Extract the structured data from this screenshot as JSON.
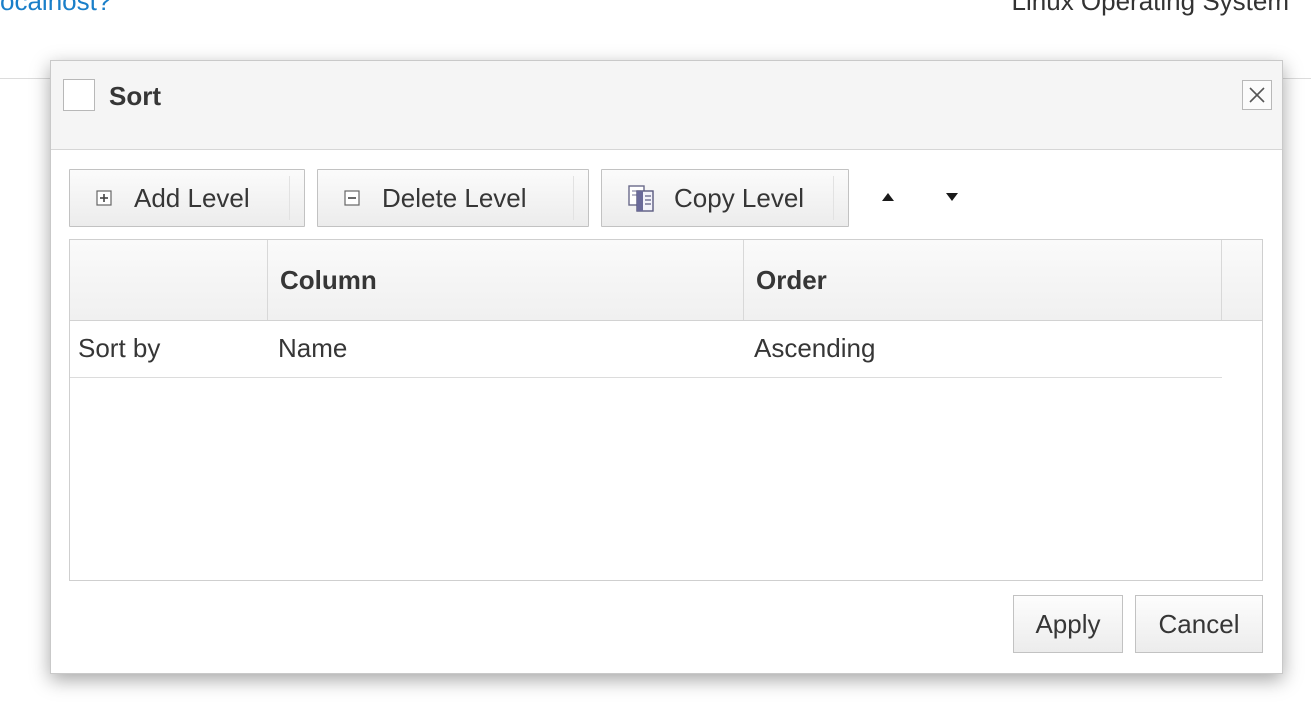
{
  "background": {
    "left_link_text": "ocalhost?",
    "right_text": "Linux Operating System"
  },
  "dialog": {
    "title": "Sort",
    "close_icon": "close-icon"
  },
  "toolbar": {
    "add_level_label": "Add Level",
    "delete_level_label": "Delete Level",
    "copy_level_label": "Copy Level",
    "move_up_icon": "triangle-up-icon",
    "move_down_icon": "triangle-down-icon"
  },
  "grid": {
    "headers": [
      "",
      "Column",
      "Order"
    ],
    "rows": [
      {
        "level": "Sort by",
        "column": "Name",
        "order": "Ascending"
      }
    ]
  },
  "footer": {
    "apply_label": "Apply",
    "cancel_label": "Cancel"
  },
  "colors": {
    "link": "#1a7fc9",
    "text": "#363636",
    "header_bg": "#f5f5f5",
    "border": "#c2c2c2"
  }
}
